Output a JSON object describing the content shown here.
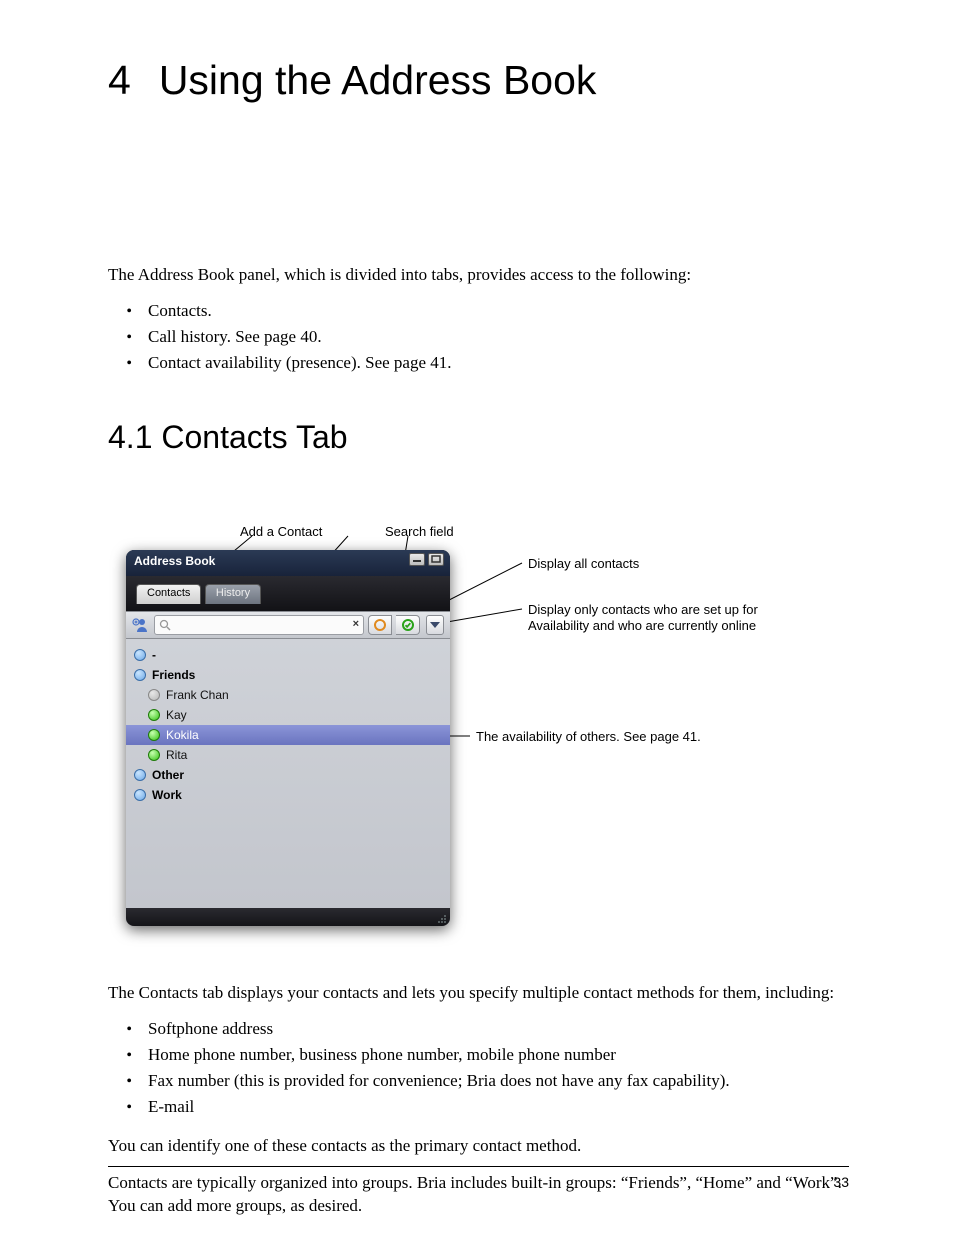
{
  "chapter": {
    "number": "4",
    "title": "Using the Address Book"
  },
  "intro_para": "The Address Book panel, which is divided into tabs, provides access to the following:",
  "intro_bullets": [
    "Contacts.",
    "Call history. See page 40.",
    "Contact availability (presence). See page 41."
  ],
  "section": {
    "heading": "4.1 Contacts Tab"
  },
  "figure": {
    "callouts": {
      "add_contact": "Add a Contact",
      "search_field": "Search field",
      "display_all": "Display all contacts",
      "display_online_1": "Display only contacts who are set up for",
      "display_online_2": "Availability and who are currently online",
      "availability": "The availability of others. See page 41."
    },
    "window": {
      "title": "Address Book",
      "tabs": {
        "active": "Contacts",
        "inactive": "History"
      },
      "search_value": "",
      "groups_and_contacts": [
        {
          "type": "root",
          "label": "-"
        },
        {
          "type": "group",
          "label": "Friends"
        },
        {
          "type": "contact",
          "label": "Frank Chan",
          "presence": "offline"
        },
        {
          "type": "contact",
          "label": "Kay",
          "presence": "available"
        },
        {
          "type": "contact",
          "label": "Kokila",
          "presence": "available",
          "selected": true
        },
        {
          "type": "contact",
          "label": "Rita",
          "presence": "available"
        },
        {
          "type": "group",
          "label": "Other"
        },
        {
          "type": "group",
          "label": "Work"
        }
      ]
    }
  },
  "after_para": "The Contacts tab displays your contacts and lets you specify multiple contact methods for them, including:",
  "after_bullets": [
    "Softphone address",
    "Home phone number, business phone number, mobile phone number",
    "Fax number (this is provided for convenience; Bria does not have any fax capability).",
    "E-mail"
  ],
  "para_primary": "You can identify one of these contacts as the primary contact method.",
  "para_groups": "Contacts are typically organized into groups. Bria includes built-in groups: “Friends”, “Home” and “Work”. You can add more groups, as desired.",
  "page_number": "33"
}
